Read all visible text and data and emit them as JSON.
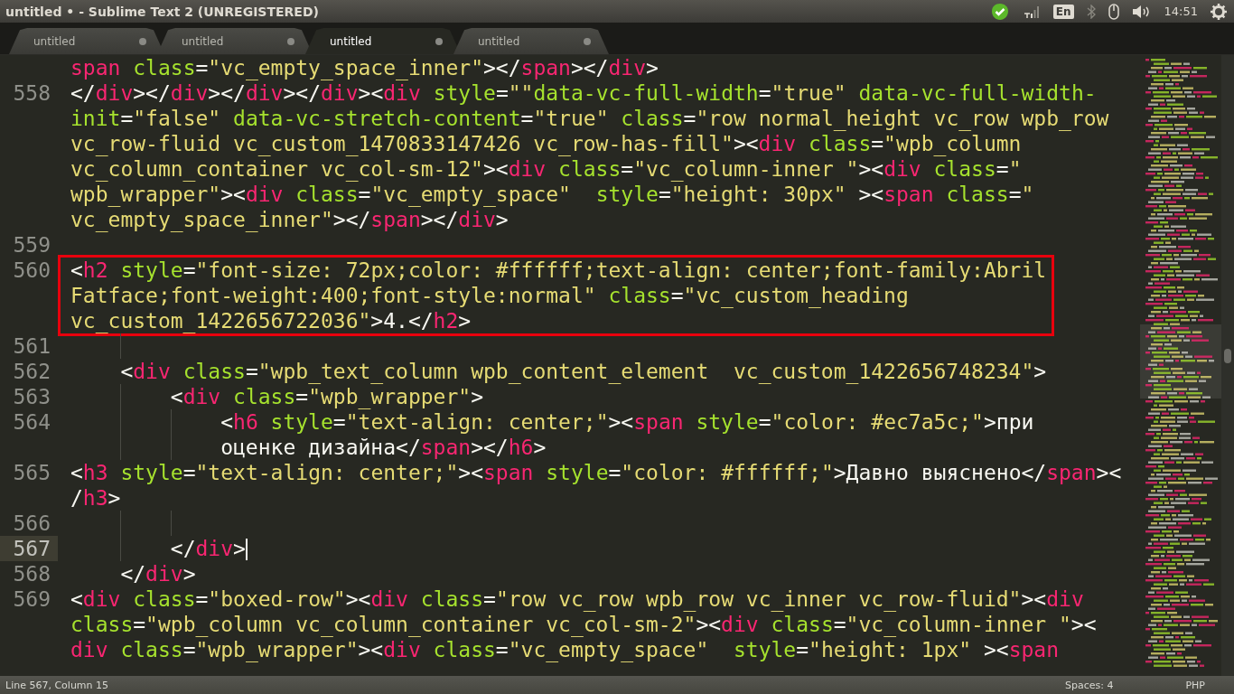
{
  "window": {
    "title": "untitled • - Sublime Text 2 (UNREGISTERED)"
  },
  "tray": {
    "language": "En",
    "clock": "14:51"
  },
  "tabs": [
    {
      "label": "untitled",
      "selected": false,
      "modified": true
    },
    {
      "label": "untitled",
      "selected": false,
      "modified": true
    },
    {
      "label": "untitled",
      "selected": true,
      "modified": true
    },
    {
      "label": "untitled",
      "selected": false,
      "modified": true
    }
  ],
  "editor": {
    "lines": [
      {
        "boxed": false,
        "current": false,
        "rows": [
          {
            "segments": [
              {
                "kind": "tag",
                "text": "span"
              },
              {
                "kind": "attr",
                "text": " class"
              },
              {
                "kind": "punct",
                "text": "="
              },
              {
                "kind": "str",
                "text": "\"vc_empty_space_inner\""
              },
              {
                "kind": "punct",
                "text": "></"
              },
              {
                "kind": "tag",
                "text": "span"
              },
              {
                "kind": "punct",
                "text": "></"
              },
              {
                "kind": "tag",
                "text": "div"
              },
              {
                "kind": "punct",
                "text": ">"
              }
            ]
          }
        ]
      },
      {
        "number": "558",
        "boxed": false,
        "current": false,
        "rows": [
          {
            "segments": [
              {
                "kind": "punct",
                "text": "</"
              },
              {
                "kind": "tag",
                "text": "div"
              },
              {
                "kind": "punct",
                "text": "></"
              },
              {
                "kind": "tag",
                "text": "div"
              },
              {
                "kind": "punct",
                "text": "></"
              },
              {
                "kind": "tag",
                "text": "div"
              },
              {
                "kind": "punct",
                "text": "></"
              },
              {
                "kind": "tag",
                "text": "div"
              },
              {
                "kind": "punct",
                "text": "><"
              },
              {
                "kind": "tag",
                "text": "div"
              },
              {
                "kind": "attr",
                "text": " style"
              },
              {
                "kind": "punct",
                "text": "="
              },
              {
                "kind": "str",
                "text": "\"\""
              },
              {
                "kind": "attr",
                "text": "data-vc-full-width"
              },
              {
                "kind": "punct",
                "text": "="
              },
              {
                "kind": "str",
                "text": "\"true\""
              },
              {
                "kind": "attr",
                "text": " data-vc-full-width-"
              }
            ]
          },
          {
            "segments": [
              {
                "kind": "attr",
                "text": "init"
              },
              {
                "kind": "punct",
                "text": "="
              },
              {
                "kind": "str",
                "text": "\"false\""
              },
              {
                "kind": "attr",
                "text": " data-vc-stretch-content"
              },
              {
                "kind": "punct",
                "text": "="
              },
              {
                "kind": "str",
                "text": "\"true\""
              },
              {
                "kind": "attr",
                "text": " class"
              },
              {
                "kind": "punct",
                "text": "="
              },
              {
                "kind": "str",
                "text": "\"row normal_height vc_row wpb_row"
              }
            ]
          },
          {
            "segments": [
              {
                "kind": "str",
                "text": "vc_row-fluid vc_custom_1470833147426 vc_row-has-fill\""
              },
              {
                "kind": "punct",
                "text": "><"
              },
              {
                "kind": "tag",
                "text": "div"
              },
              {
                "kind": "attr",
                "text": " class"
              },
              {
                "kind": "punct",
                "text": "="
              },
              {
                "kind": "str",
                "text": "\"wpb_column"
              }
            ]
          },
          {
            "segments": [
              {
                "kind": "str",
                "text": "vc_column_container vc_col-sm-12\""
              },
              {
                "kind": "punct",
                "text": "><"
              },
              {
                "kind": "tag",
                "text": "div"
              },
              {
                "kind": "attr",
                "text": " class"
              },
              {
                "kind": "punct",
                "text": "="
              },
              {
                "kind": "str",
                "text": "\"vc_column-inner \""
              },
              {
                "kind": "punct",
                "text": "><"
              },
              {
                "kind": "tag",
                "text": "div"
              },
              {
                "kind": "attr",
                "text": " class"
              },
              {
                "kind": "punct",
                "text": "="
              },
              {
                "kind": "str",
                "text": "\""
              }
            ]
          },
          {
            "segments": [
              {
                "kind": "str",
                "text": "wpb_wrapper\""
              },
              {
                "kind": "punct",
                "text": "><"
              },
              {
                "kind": "tag",
                "text": "div"
              },
              {
                "kind": "attr",
                "text": " class"
              },
              {
                "kind": "punct",
                "text": "="
              },
              {
                "kind": "str",
                "text": "\"vc_empty_space\""
              },
              {
                "kind": "attr",
                "text": "  style"
              },
              {
                "kind": "punct",
                "text": "="
              },
              {
                "kind": "str",
                "text": "\"height: 30px\""
              },
              {
                "kind": "punct",
                "text": " ><"
              },
              {
                "kind": "tag",
                "text": "span"
              },
              {
                "kind": "attr",
                "text": " class"
              },
              {
                "kind": "punct",
                "text": "="
              },
              {
                "kind": "str",
                "text": "\""
              }
            ]
          },
          {
            "segments": [
              {
                "kind": "str",
                "text": "vc_empty_space_inner\""
              },
              {
                "kind": "punct",
                "text": "></"
              },
              {
                "kind": "tag",
                "text": "span"
              },
              {
                "kind": "punct",
                "text": "></"
              },
              {
                "kind": "tag",
                "text": "div"
              },
              {
                "kind": "punct",
                "text": ">"
              }
            ]
          }
        ]
      },
      {
        "number": "559",
        "boxed": false,
        "current": false,
        "rows": [
          {
            "segments": []
          }
        ]
      },
      {
        "number": "560",
        "boxed": true,
        "current": false,
        "rows": [
          {
            "segments": [
              {
                "kind": "punct",
                "text": "<"
              },
              {
                "kind": "tag",
                "text": "h2"
              },
              {
                "kind": "attr",
                "text": " style"
              },
              {
                "kind": "punct",
                "text": "="
              },
              {
                "kind": "str",
                "text": "\"font-size: 72px;color: #ffffff;text-align: center;font-family:Abril"
              }
            ]
          },
          {
            "segments": [
              {
                "kind": "str",
                "text": "Fatface;font-weight:400;font-style:normal\""
              },
              {
                "kind": "attr",
                "text": " class"
              },
              {
                "kind": "punct",
                "text": "="
              },
              {
                "kind": "str",
                "text": "\"vc_custom_heading"
              }
            ]
          },
          {
            "segments": [
              {
                "kind": "str",
                "text": "vc_custom_1422656722036\""
              },
              {
                "kind": "punct",
                "text": ">4.</"
              },
              {
                "kind": "tag",
                "text": "h2"
              },
              {
                "kind": "punct",
                "text": ">"
              }
            ]
          }
        ]
      },
      {
        "number": "561",
        "boxed": false,
        "current": false,
        "rows": [
          {
            "segments": [],
            "guides": [
              {
                "kind": "indent"
              }
            ]
          }
        ]
      },
      {
        "number": "562",
        "boxed": false,
        "current": false,
        "rows": [
          {
            "segments": [
              {
                "kind": "punct",
                "text": "    <"
              },
              {
                "kind": "tag",
                "text": "div"
              },
              {
                "kind": "attr",
                "text": " class"
              },
              {
                "kind": "punct",
                "text": "="
              },
              {
                "kind": "str",
                "text": "\"wpb_text_column wpb_content_element  vc_custom_1422656748234\""
              },
              {
                "kind": "punct",
                "text": ">"
              }
            ]
          }
        ]
      },
      {
        "number": "563",
        "boxed": false,
        "current": false,
        "rows": [
          {
            "segments": [
              {
                "kind": "punct",
                "text": "        <"
              },
              {
                "kind": "tag",
                "text": "div"
              },
              {
                "kind": "attr",
                "text": " class"
              },
              {
                "kind": "punct",
                "text": "="
              },
              {
                "kind": "str",
                "text": "\"wpb_wrapper\""
              },
              {
                "kind": "punct",
                "text": ">"
              }
            ],
            "guides": [
              {
                "kind": "indent"
              }
            ]
          }
        ]
      },
      {
        "number": "564",
        "boxed": false,
        "current": false,
        "rows": [
          {
            "segments": [
              {
                "kind": "punct",
                "text": "            <"
              },
              {
                "kind": "tag",
                "text": "h6"
              },
              {
                "kind": "attr",
                "text": " style"
              },
              {
                "kind": "punct",
                "text": "="
              },
              {
                "kind": "str",
                "text": "\"text-align: center;\""
              },
              {
                "kind": "punct",
                "text": "><"
              },
              {
                "kind": "tag",
                "text": "span"
              },
              {
                "kind": "attr",
                "text": " style"
              },
              {
                "kind": "punct",
                "text": "="
              },
              {
                "kind": "str",
                "text": "\"color: #ec7a5c;\""
              },
              {
                "kind": "punct",
                "text": ">при"
              }
            ],
            "guides": [
              {
                "kind": "indent"
              },
              {
                "kind": "indent"
              }
            ]
          },
          {
            "segments": [
              {
                "kind": "punct",
                "text": "            оценке дизайна</"
              },
              {
                "kind": "tag",
                "text": "span"
              },
              {
                "kind": "punct",
                "text": "></"
              },
              {
                "kind": "tag",
                "text": "h6"
              },
              {
                "kind": "punct",
                "text": ">"
              }
            ],
            "guides": [
              {
                "kind": "indent"
              },
              {
                "kind": "indent"
              }
            ]
          }
        ]
      },
      {
        "number": "565",
        "boxed": false,
        "current": false,
        "rows": [
          {
            "segments": [
              {
                "kind": "punct",
                "text": "<"
              },
              {
                "kind": "tag",
                "text": "h3"
              },
              {
                "kind": "attr",
                "text": " style"
              },
              {
                "kind": "punct",
                "text": "="
              },
              {
                "kind": "str",
                "text": "\"text-align: center;\""
              },
              {
                "kind": "punct",
                "text": "><"
              },
              {
                "kind": "tag",
                "text": "span"
              },
              {
                "kind": "attr",
                "text": " style"
              },
              {
                "kind": "punct",
                "text": "="
              },
              {
                "kind": "str",
                "text": "\"color: #ffffff;\""
              },
              {
                "kind": "punct",
                "text": ">Давно выяснено</"
              },
              {
                "kind": "tag",
                "text": "span"
              },
              {
                "kind": "punct",
                "text": "><"
              }
            ]
          },
          {
            "segments": [
              {
                "kind": "punct",
                "text": "/"
              },
              {
                "kind": "tag",
                "text": "h3"
              },
              {
                "kind": "punct",
                "text": ">"
              }
            ]
          }
        ]
      },
      {
        "number": "566",
        "boxed": false,
        "current": false,
        "rows": [
          {
            "segments": [],
            "guides": [
              {
                "kind": "indent"
              },
              {
                "kind": "indent"
              }
            ]
          }
        ]
      },
      {
        "number": "567",
        "boxed": false,
        "current": true,
        "rows": [
          {
            "segments": [
              {
                "kind": "punct",
                "text": "        </"
              },
              {
                "kind": "tag",
                "text": "div"
              },
              {
                "kind": "punct",
                "text": ">"
              }
            ],
            "guides": [
              {
                "kind": "indent"
              }
            ]
          }
        ]
      },
      {
        "number": "568",
        "boxed": false,
        "current": false,
        "rows": [
          {
            "segments": [
              {
                "kind": "punct",
                "text": "    </"
              },
              {
                "kind": "tag",
                "text": "div"
              },
              {
                "kind": "punct",
                "text": ">"
              }
            ]
          }
        ]
      },
      {
        "number": "569",
        "boxed": false,
        "current": false,
        "rows": [
          {
            "segments": [
              {
                "kind": "punct",
                "text": "<"
              },
              {
                "kind": "tag",
                "text": "div"
              },
              {
                "kind": "attr",
                "text": " class"
              },
              {
                "kind": "punct",
                "text": "="
              },
              {
                "kind": "str",
                "text": "\"boxed-row\""
              },
              {
                "kind": "punct",
                "text": "><"
              },
              {
                "kind": "tag",
                "text": "div"
              },
              {
                "kind": "attr",
                "text": " class"
              },
              {
                "kind": "punct",
                "text": "="
              },
              {
                "kind": "str",
                "text": "\"row vc_row wpb_row vc_inner vc_row-fluid\""
              },
              {
                "kind": "punct",
                "text": "><"
              },
              {
                "kind": "tag",
                "text": "div"
              }
            ]
          },
          {
            "segments": [
              {
                "kind": "attr",
                "text": "class"
              },
              {
                "kind": "punct",
                "text": "="
              },
              {
                "kind": "str",
                "text": "\"wpb_column vc_column_container vc_col-sm-2\""
              },
              {
                "kind": "punct",
                "text": "><"
              },
              {
                "kind": "tag",
                "text": "div"
              },
              {
                "kind": "attr",
                "text": " class"
              },
              {
                "kind": "punct",
                "text": "="
              },
              {
                "kind": "str",
                "text": "\"vc_column-inner \""
              },
              {
                "kind": "punct",
                "text": "><"
              }
            ]
          },
          {
            "segments": [
              {
                "kind": "tag",
                "text": "div"
              },
              {
                "kind": "attr",
                "text": " class"
              },
              {
                "kind": "punct",
                "text": "="
              },
              {
                "kind": "str",
                "text": "\"wpb_wrapper\""
              },
              {
                "kind": "punct",
                "text": "><"
              },
              {
                "kind": "tag",
                "text": "div"
              },
              {
                "kind": "attr",
                "text": " class"
              },
              {
                "kind": "punct",
                "text": "="
              },
              {
                "kind": "str",
                "text": "\"vc_empty_space\""
              },
              {
                "kind": "attr",
                "text": "  style"
              },
              {
                "kind": "punct",
                "text": "="
              },
              {
                "kind": "str",
                "text": "\"height: 1px\""
              },
              {
                "kind": "punct",
                "text": " ><"
              },
              {
                "kind": "tag",
                "text": "span"
              }
            ]
          }
        ]
      }
    ]
  },
  "status_bar": {
    "position": "Line 567, Column 15",
    "indentation": "Spaces: 4",
    "syntax": "PHP"
  }
}
